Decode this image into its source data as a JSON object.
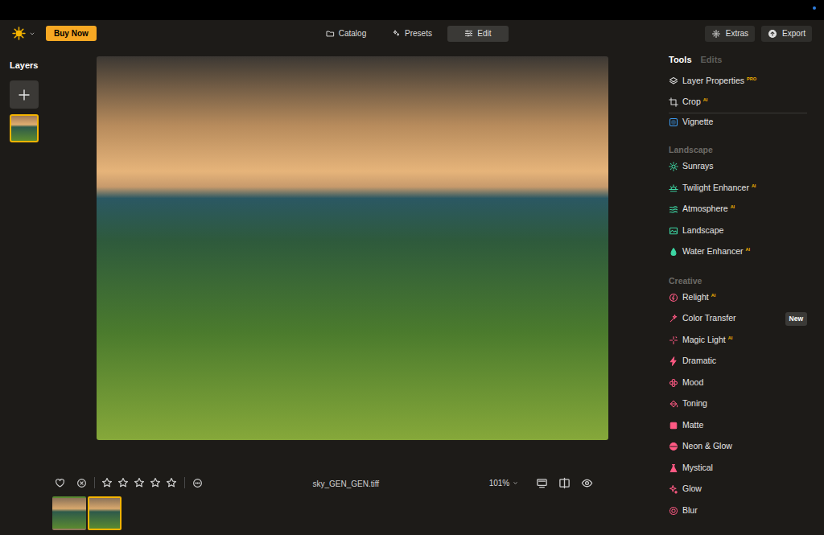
{
  "toolbar": {
    "buy_button": "Buy Now",
    "tabs": [
      {
        "label": "Catalog",
        "selected": false
      },
      {
        "label": "Presets",
        "selected": false
      },
      {
        "label": "Edit",
        "selected": true
      }
    ],
    "actions": [
      "Extras",
      "Export"
    ]
  },
  "layers": {
    "title": "Layers",
    "items": [
      {
        "selected": true
      }
    ]
  },
  "panel": {
    "tabs": [
      {
        "label": "Tools",
        "selected": true
      },
      {
        "label": "Edits",
        "selected": false
      }
    ],
    "top_tools": [
      {
        "label": "Layer Properties",
        "badge": "PRO",
        "color": "#d9d9d9"
      },
      {
        "label": "Crop",
        "badge": "AI",
        "color": "#d9d9d9"
      },
      {
        "label": "Vignette",
        "color": "#3d9df5"
      }
    ],
    "sections": [
      {
        "title": "Landscape",
        "items": [
          {
            "label": "Sunrays",
            "color": "#3dd6a3"
          },
          {
            "label": "Twilight Enhancer",
            "badge": "AI",
            "color": "#3dd6a3"
          },
          {
            "label": "Atmosphere",
            "badge": "AI",
            "color": "#3dd6a3"
          },
          {
            "label": "Landscape",
            "color": "#3dd6a3"
          },
          {
            "label": "Water Enhancer",
            "badge": "AI",
            "color": "#3dd6a3"
          }
        ]
      },
      {
        "title": "Creative",
        "items": [
          {
            "label": "Relight",
            "badge": "AI",
            "color": "#ff5a84"
          },
          {
            "label": "Color Transfer",
            "tag": "New",
            "color": "#ff5a84"
          },
          {
            "label": "Magic Light",
            "badge": "AI",
            "color": "#ff5a84"
          },
          {
            "label": "Dramatic",
            "color": "#ff5a84"
          },
          {
            "label": "Mood",
            "color": "#ff5a84"
          },
          {
            "label": "Toning",
            "color": "#ff5a84"
          },
          {
            "label": "Matte",
            "color": "#ff5a84"
          },
          {
            "label": "Neon & Glow",
            "color": "#ff5a84"
          },
          {
            "label": "Mystical",
            "color": "#ff5a84"
          },
          {
            "label": "Glow",
            "color": "#ff5a84"
          },
          {
            "label": "Blur",
            "color": "#ff5a84"
          }
        ]
      }
    ]
  },
  "bottom_bar": {
    "favorite": false,
    "rejected": false,
    "stars": 0,
    "filename": "sky_GEN_GEN.tiff",
    "zoom": "101%"
  },
  "filmstrip": [
    {
      "selected": false
    },
    {
      "selected": true
    }
  ]
}
